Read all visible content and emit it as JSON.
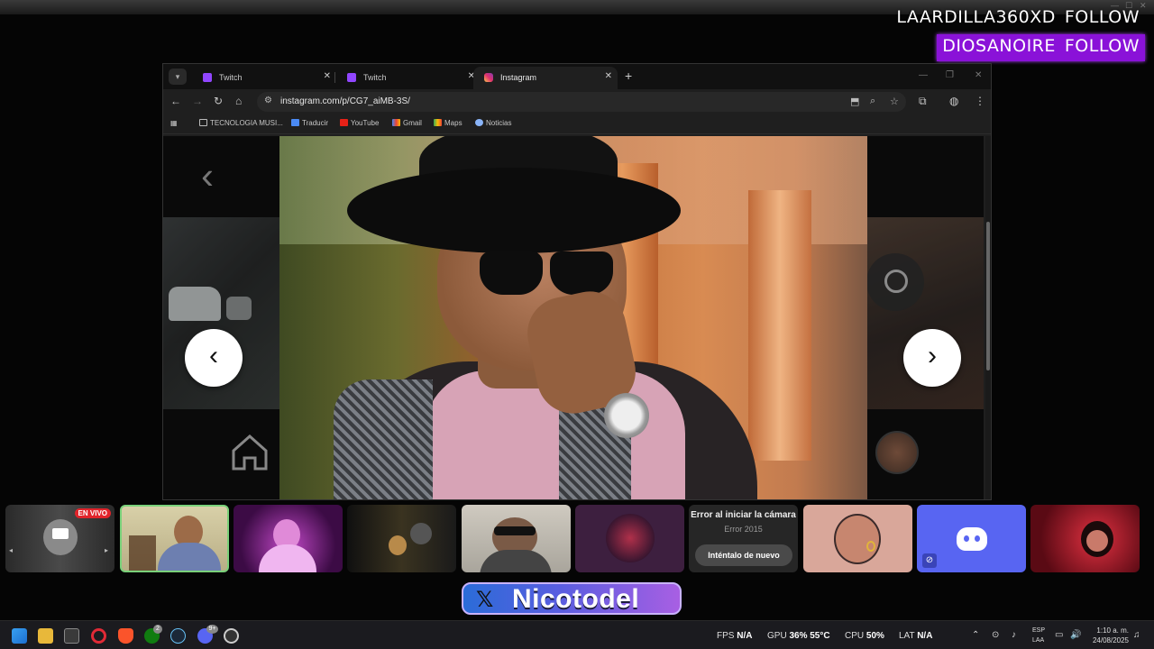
{
  "alerts": [
    {
      "user": "LAARDILLA360XD",
      "action": "FOLLOW"
    },
    {
      "user": "DIOSANOIRE",
      "action": "FOLLOW"
    }
  ],
  "browser": {
    "tabs": [
      {
        "label": "Twitch",
        "active": false
      },
      {
        "label": "Twitch",
        "active": false
      },
      {
        "label": "Instagram",
        "active": true
      }
    ],
    "url": "instagram.com/p/CG7_aiMB-3S/",
    "bookmarks": [
      {
        "label": "TECNOLOGIA MUSI...",
        "icon": "folder-icon"
      },
      {
        "label": "Traducir",
        "icon": "translate-icon"
      },
      {
        "label": "YouTube",
        "icon": "youtube-icon"
      },
      {
        "label": "Gmail",
        "icon": "gmail-icon"
      },
      {
        "label": "Maps",
        "icon": "maps-icon"
      },
      {
        "label": "Noticias",
        "icon": "news-icon"
      }
    ]
  },
  "cam_strip": {
    "live_badge": "EN VIVO",
    "error_title": "Error al iniciar la cámara",
    "error_code": "Error 2015",
    "retry_label": "Inténtalo de nuevo"
  },
  "banner": {
    "handle": "Nicotodel",
    "icon": "x-logo-icon"
  },
  "taskbar": {
    "fps_label": "FPS",
    "fps_value": "N/A",
    "gpu_label": "GPU",
    "gpu_value": "36%",
    "gpu_temp": "55°C",
    "cpu_label": "CPU",
    "cpu_value": "50%",
    "lat_label": "LAT",
    "lat_value": "N/A",
    "lang_1": "ESP",
    "lang_2": "LAA",
    "time": "1:10 a. m.",
    "date": "24/08/2025",
    "badge_xbox": "2",
    "badge_discord": "9+"
  },
  "colors": {
    "alert_bg": "#8a12d8",
    "twitch": "#9146ff",
    "discord": "#5865f2",
    "live": "#e0242b"
  }
}
